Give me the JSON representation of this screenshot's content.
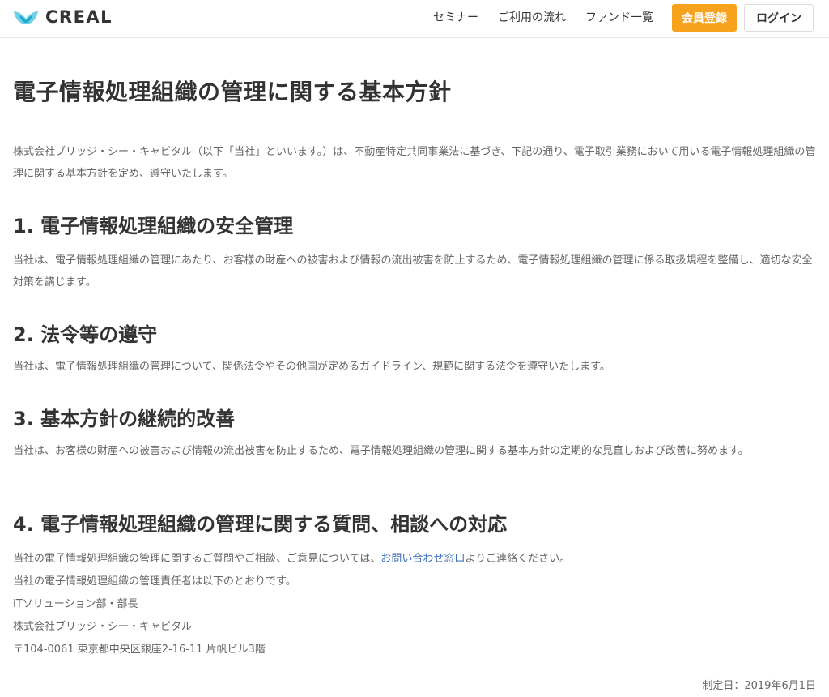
{
  "header": {
    "logo_text": "CREAL",
    "nav": [
      "セミナー",
      "ご利用の流れ",
      "ファンド一覧"
    ],
    "register_label": "会員登録",
    "login_label": "ログイン",
    "accent_color": "#f7a21c",
    "logo_color": "#2bb6d6"
  },
  "page": {
    "title": "電子情報処理組織の管理に関する基本方針",
    "intro": "株式会社ブリッジ・シー・キャピタル（以下「当社」といいます。）は、不動産特定共同事業法に基づき、下記の通り、電子取引業務において用いる電子情報処理組織の管理に関する基本方針を定め、遵守いたします。",
    "sections": [
      {
        "heading": "1. 電子情報処理組織の安全管理",
        "body": "当社は、電子情報処理組織の管理にあたり、お客様の財産への被害および情報の流出被害を防止するため、電子情報処理組織の管理に係る取扱規程を整備し、適切な安全対策を講じます。"
      },
      {
        "heading": "2. 法令等の遵守",
        "body": "当社は、電子情報処理組織の管理について、関係法令やその他国が定めるガイドライン、規範に関する法令を遵守いたします。"
      },
      {
        "heading": "3. 基本方針の継続的改善",
        "body": "当社は、お客様の財産への被害および情報の流出被害を防止するため、電子情報処理組織の管理に関する基本方針の定期的な見直しおよび改善に努めます。"
      },
      {
        "heading": "4. 電子情報処理組織の管理に関する質問、相談への対応",
        "body_pre": "当社の電子情報処理組織の管理に関するご質問やご相談、ご意見については、",
        "body_link": "お問い合わせ窓口",
        "body_post": "よりご連絡ください。",
        "lines": [
          "当社の電子情報処理組織の管理責任者は以下のとおりです。",
          "ITソリューション部・部長",
          "株式会社ブリッジ・シー・キャピタル",
          "〒104-0061 東京都中央区銀座2-16-11 片帆ビル3階"
        ]
      }
    ],
    "enacted_date": "制定日：2019年6月1日"
  }
}
